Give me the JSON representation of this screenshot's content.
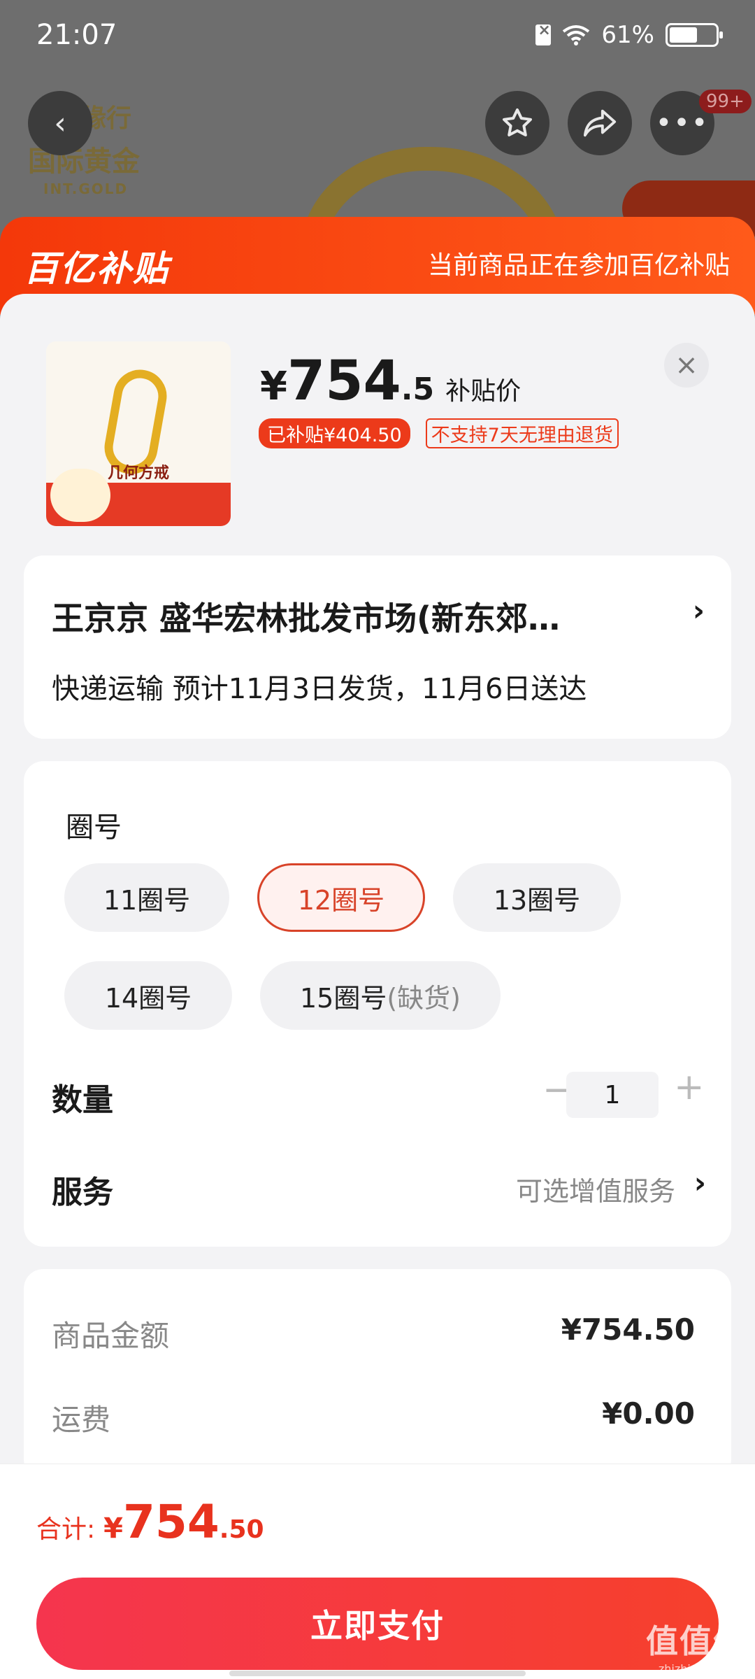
{
  "status_bar": {
    "time": "21:07",
    "battery_text": "61%",
    "battery_level": 0.61
  },
  "header": {
    "badge": "99+"
  },
  "background": {
    "logo_line1": "金缘行",
    "logo_line2": "国际黄金",
    "logo_line3": "INT.GOLD"
  },
  "banner": {
    "logo": "百亿补贴",
    "text": "当前商品正在参加百亿补贴"
  },
  "product": {
    "thumbnail_title": "几何方戒",
    "price_symbol": "¥",
    "price_main": "754",
    "price_decimal": ".5",
    "price_label": "补贴价",
    "tag_subsidy": "已补贴¥404.50",
    "tag_noreturn": "不支持7天无理由退货"
  },
  "address": {
    "line": "王京京  盛华宏林批发市场(新东郊…",
    "shipping": "快递运输 预计11月3日发货，11月6日送达"
  },
  "spec": {
    "title": "圈号",
    "options": [
      {
        "label": "11圈号",
        "selected": false
      },
      {
        "label": "12圈号",
        "selected": true
      },
      {
        "label": "13圈号",
        "selected": false
      },
      {
        "label": "14圈号",
        "selected": false
      },
      {
        "label": "15圈号",
        "note": "(缺货)",
        "selected": false
      }
    ]
  },
  "quantity": {
    "label": "数量",
    "value": "1",
    "minus": "−",
    "plus": "+"
  },
  "service": {
    "label": "服务",
    "value": "可选增值服务"
  },
  "summary": {
    "goods_label": "商品金额",
    "goods_value": "¥754.50",
    "shipping_label": "运费",
    "shipping_value": "¥0.00"
  },
  "footer": {
    "total_label": "合计:",
    "total_symbol": "¥",
    "total_main": "754",
    "total_decimal": ".50",
    "pay_label": "立即支付"
  },
  "watermark": {
    "line1": "值值值",
    "line2": "zhizhizhi.com"
  },
  "colors": {
    "accent": "#e8321e",
    "banner": "#f4380a",
    "selected_border": "#d84329"
  }
}
